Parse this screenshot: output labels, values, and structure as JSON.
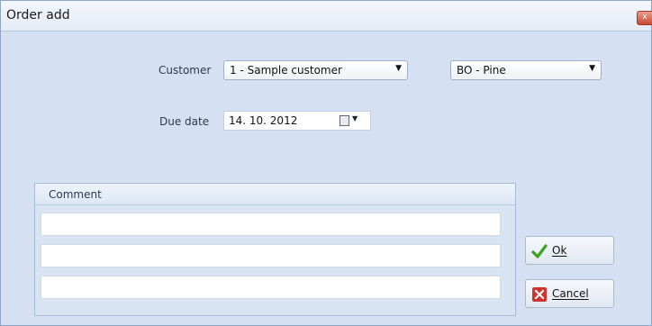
{
  "window": {
    "title": "Order add",
    "close_glyph": "x"
  },
  "customer": {
    "label": "Customer",
    "value": "1 - Sample customer",
    "icon": "chevron-down-icon"
  },
  "warehouse": {
    "value": "BO - Pine",
    "icon": "chevron-down-icon"
  },
  "due_date": {
    "label": "Due date",
    "value": "14. 10. 2012",
    "icon": "calendar-icon"
  },
  "comment": {
    "header": "Comment",
    "lines": [
      "",
      "",
      ""
    ]
  },
  "buttons": {
    "ok": {
      "mnemonic": "O",
      "rest": "k",
      "icon": "checkmark-icon",
      "icon_color": "#3aa51c"
    },
    "cancel": {
      "mnemonic": "C",
      "rest": "ancel",
      "icon": "cancel-x-icon",
      "icon_color": "#d0342c"
    }
  }
}
